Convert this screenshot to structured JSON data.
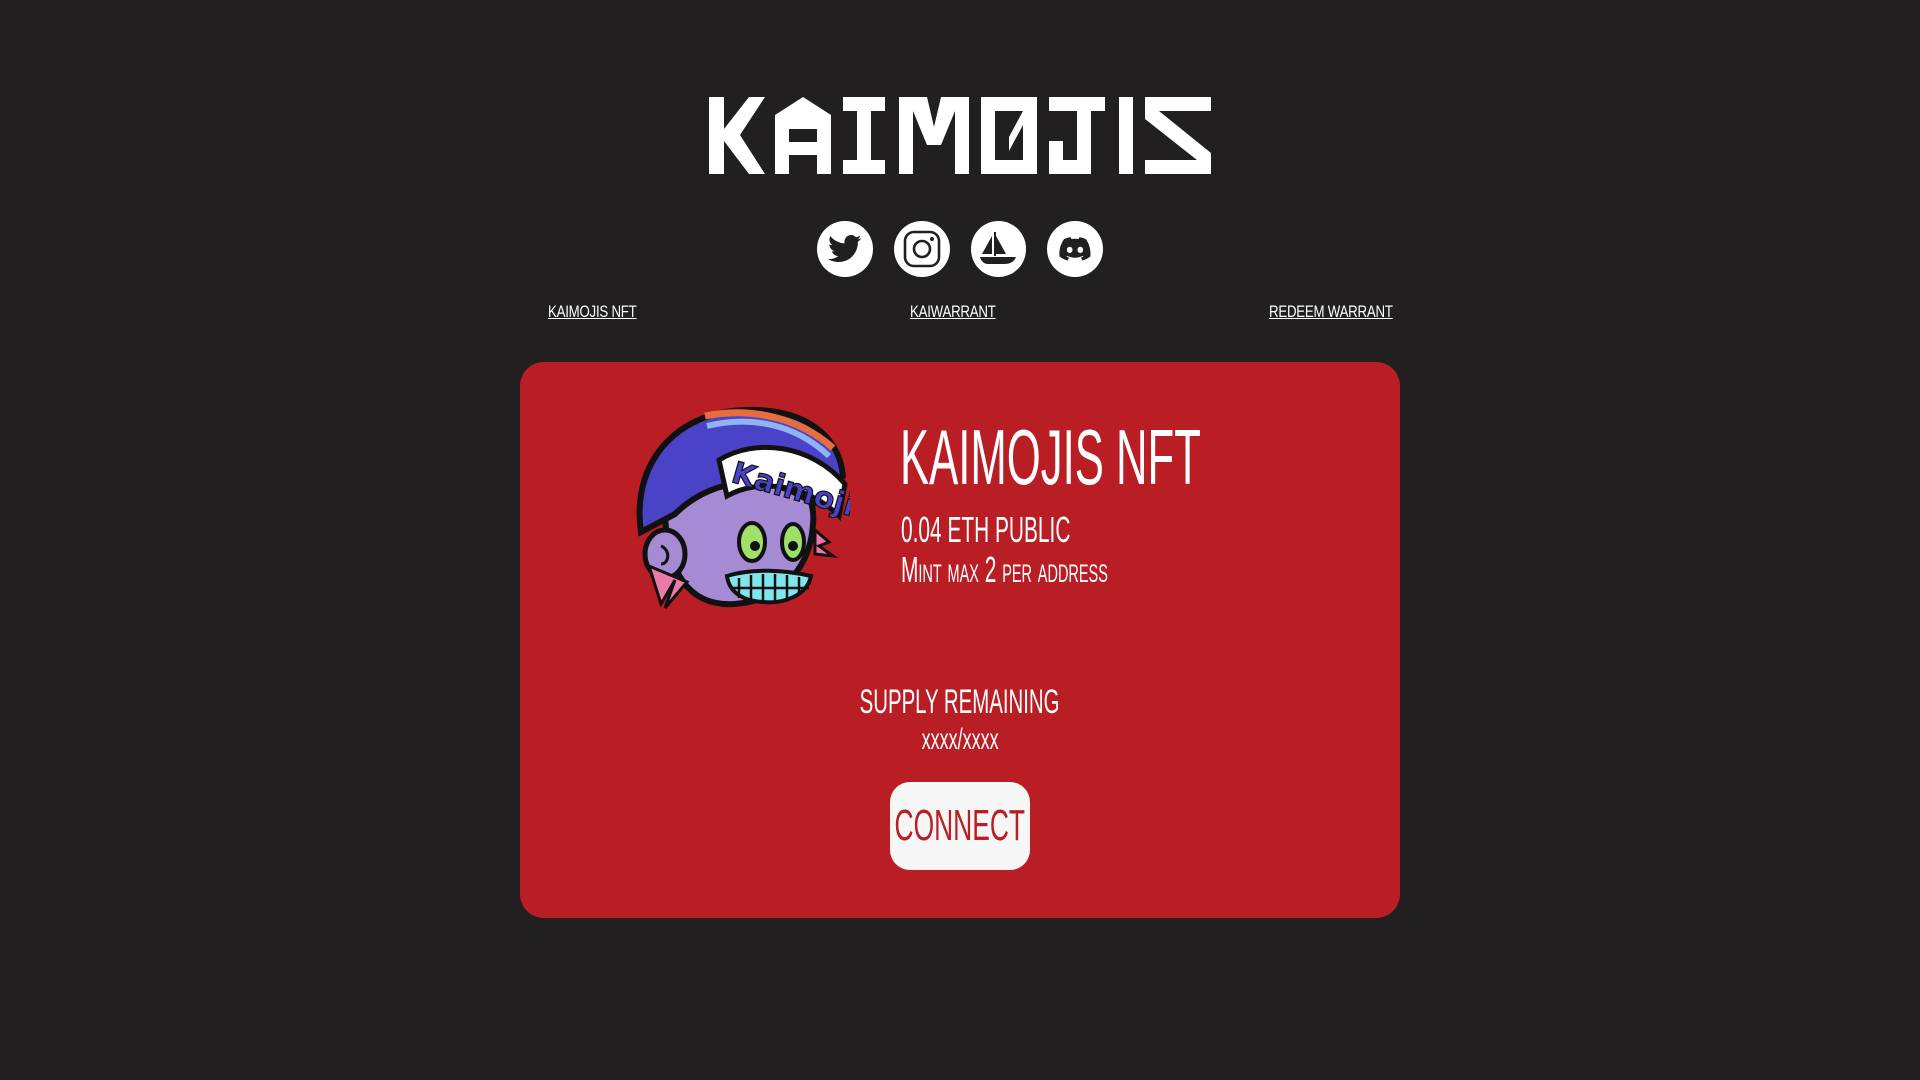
{
  "header": {
    "logo_text": "KAIMOJIS"
  },
  "socials": [
    {
      "name": "twitter-icon"
    },
    {
      "name": "instagram-icon"
    },
    {
      "name": "opensea-icon"
    },
    {
      "name": "discord-icon"
    }
  ],
  "nav": {
    "link_1": "KAIMOJIS NFT",
    "link_2": "KAIWARRANT",
    "link_3": "REDEEM WARRANT"
  },
  "card": {
    "title": "KAIMOJIS NFT",
    "price_line": "0.04 ETH PUBLIC",
    "max_line": "Mint max 2 per address",
    "supply_label": "SUPPLY REMAINING",
    "supply_value": "xxxx/xxxx",
    "connect_label": "CONNECT",
    "avatar_cap_text": "Kaimojis"
  },
  "colors": {
    "background": "#221f20",
    "card": "#ba1e25",
    "button": "#f6f6f6",
    "text": "#ffffff"
  }
}
